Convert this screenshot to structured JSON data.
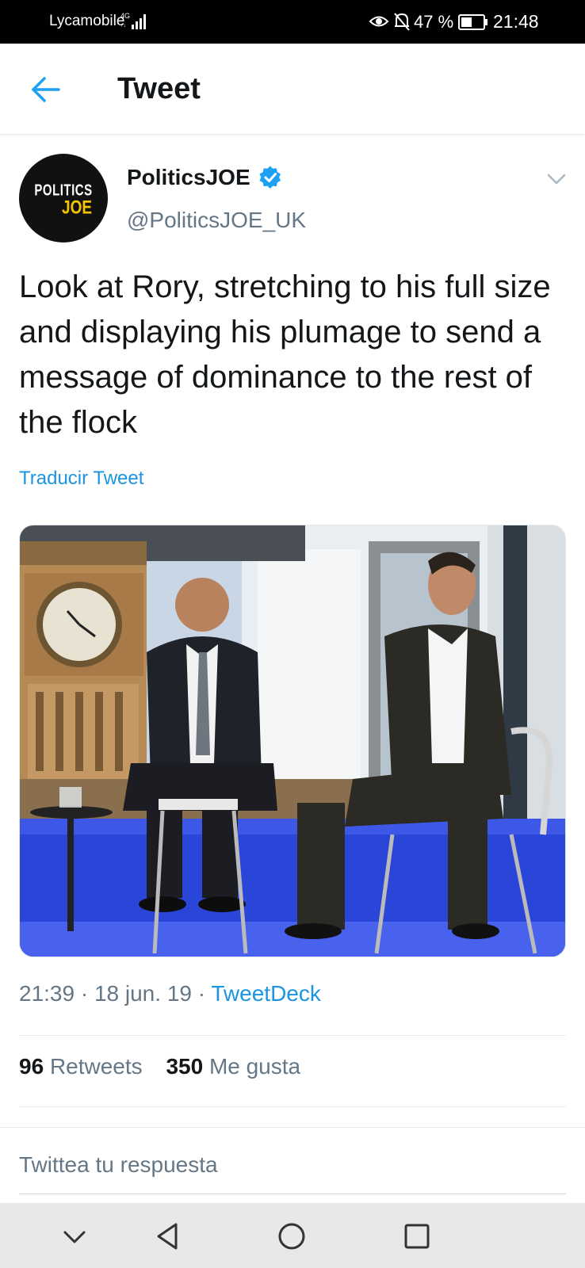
{
  "status_bar": {
    "carrier": "Lycamobile",
    "network_type": "4G",
    "battery_percent": "47 %",
    "time": "21:48",
    "icons": [
      "signal-icon",
      "eye-icon",
      "bell-off-icon",
      "battery-icon"
    ]
  },
  "header": {
    "back_icon": "arrow-left-icon",
    "title": "Tweet"
  },
  "tweet": {
    "author": {
      "avatar_line1": "POLITICS",
      "avatar_line2": "JOE",
      "display_name": "PoliticsJOE",
      "verified": true,
      "handle": "@PoliticsJOE_UK"
    },
    "text": "Look at Rory, stretching to his full size and displaying his plumage to send a message of dominance to the rest of the flock",
    "translate_label": "Traducir Tweet",
    "time": "21:39",
    "date": "18 jun. 19",
    "source": "TweetDeck",
    "retweets_count": "96",
    "retweets_label": "Retweets",
    "likes_count": "350",
    "likes_label": "Me gusta"
  },
  "reply": {
    "placeholder": "Twittea tu respuesta"
  },
  "nav_bar": {
    "icons": [
      "chevron-down-icon",
      "back-triangle-icon",
      "home-circle-icon",
      "recents-square-icon"
    ]
  },
  "colors": {
    "accent": "#1da1f2",
    "link": "#1b95e0",
    "secondary_text": "#657786",
    "logo_yellow": "#f4c400"
  }
}
